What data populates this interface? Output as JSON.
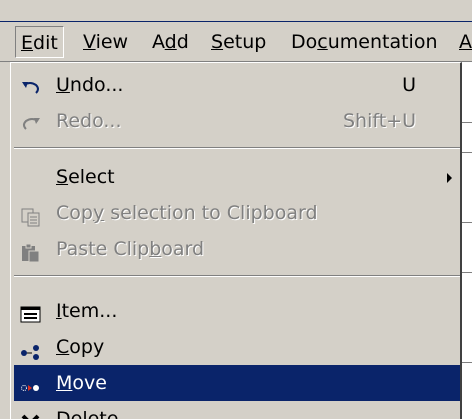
{
  "menubar": {
    "items": [
      {
        "label": "Edit",
        "mnemonic": "E"
      },
      {
        "label": "View",
        "mnemonic": "V"
      },
      {
        "label": "Add",
        "mnemonic": "d"
      },
      {
        "label": "Setup",
        "mnemonic": "S"
      },
      {
        "label": "Documentation",
        "mnemonic": "c"
      },
      {
        "label": "A",
        "mnemonic": "A"
      }
    ]
  },
  "edit_menu": {
    "undo": {
      "label": "Undo...",
      "accel": "U",
      "icon": "undo-arrow-icon"
    },
    "redo": {
      "label": "Redo...",
      "accel": "Shift+U",
      "icon": "redo-arrow-icon"
    },
    "select": {
      "label": "Select",
      "has_submenu": true
    },
    "copy_clipboard": {
      "label": "Copy selection to Clipboard",
      "icon": "copy-icon"
    },
    "paste_clipboard": {
      "label": "Paste Clipboard",
      "icon": "paste-icon"
    },
    "item": {
      "label": "Item...",
      "icon": "item-form-icon"
    },
    "copy": {
      "label": "Copy",
      "icon": "copy-dots-icon"
    },
    "move": {
      "label": "Move",
      "icon": "move-dots-icon"
    },
    "delete": {
      "label": "Delete",
      "icon": "delete-x-icon"
    }
  },
  "colors": {
    "menu_bg": "#d4d0c8",
    "highlight": "#0a246a",
    "disabled_text": "#808080"
  }
}
